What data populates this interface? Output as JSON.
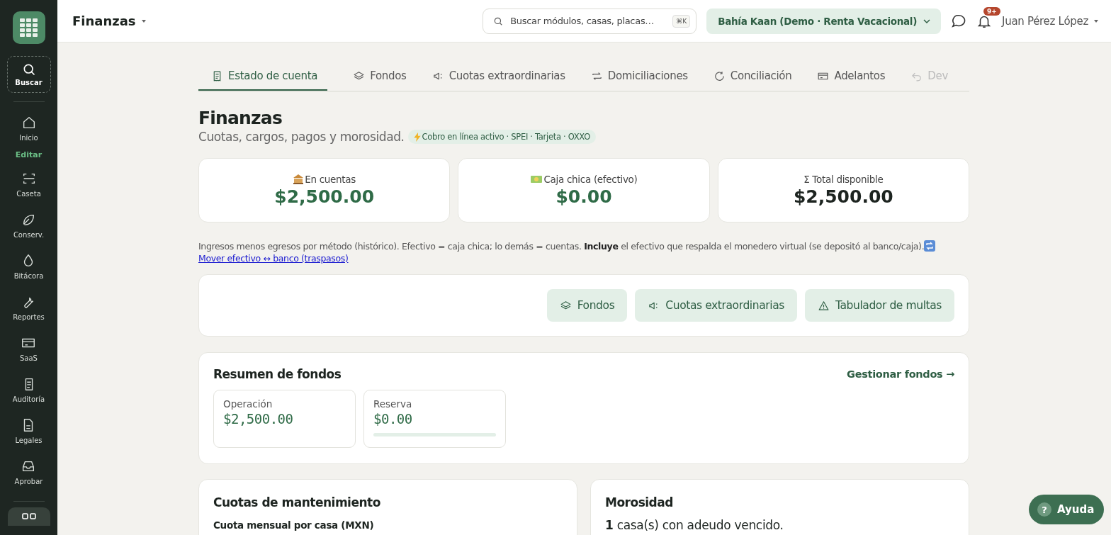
{
  "header": {
    "module": "Finanzas",
    "search": {
      "placeholder": "Buscar módulos, casas, placas…",
      "shortcut": "⌘K"
    },
    "property": "Bahía Kaan (Demo · Renta Vacacional)",
    "notifications": "9+",
    "user": "Juan Pérez López"
  },
  "sidebar": {
    "search": "Buscar",
    "items": [
      {
        "kind": "item",
        "label": "Inicio"
      },
      {
        "kind": "section",
        "label": "Editar"
      },
      {
        "kind": "item",
        "label": "Caseta"
      },
      {
        "kind": "item",
        "label": "Conserv."
      },
      {
        "kind": "item",
        "label": "Bitácora"
      },
      {
        "kind": "item",
        "label": "Reportes"
      },
      {
        "kind": "item",
        "label": "SaaS"
      },
      {
        "kind": "item",
        "label": "Auditoría"
      },
      {
        "kind": "item",
        "label": "Legales"
      },
      {
        "kind": "item",
        "label": "Aprobar"
      }
    ]
  },
  "tabs": [
    {
      "label": "Estado de cuenta",
      "selected": true
    },
    {
      "label": "Fondos",
      "selected": false
    },
    {
      "label": "Cuotas extraordinarias",
      "selected": false
    },
    {
      "label": "Domiciliaciones",
      "selected": false
    },
    {
      "label": "Conciliación",
      "selected": false
    },
    {
      "label": "Adelantos",
      "selected": false
    },
    {
      "label": "Dev",
      "selected": false
    }
  ],
  "page": {
    "title": "Finanzas",
    "subtitle": "Cuotas, cargos, pagos y morosidad.",
    "badge": "Cobro en línea activo · SPEI · Tarjeta · OXXO"
  },
  "balances": [
    {
      "label": "En cuentas",
      "amount": "$2,500.00",
      "accent": true
    },
    {
      "label": "Caja chica (efectivo)",
      "amount": "$0.00",
      "accent": true
    },
    {
      "label": "Σ Total disponible",
      "amount": "$2,500.00",
      "accent": false
    }
  ],
  "note": {
    "text": "Ingresos menos egresos por método (histórico). Efectivo = caja chica; lo demás = cuentas. **Incluye** el efectivo que respalda el monedero virtual (se depositó al banco/caja).",
    "link": "Mover efectivo ↔ banco (traspasos)"
  },
  "actions": [
    {
      "label": "Fondos"
    },
    {
      "label": "Cuotas extraordinarias"
    },
    {
      "label": "Tabulador de multas"
    }
  ],
  "funds": {
    "title": "Resumen de fondos",
    "link": "Gestionar fondos →",
    "items": [
      {
        "name": "Operación",
        "amount": "$2,500.00"
      },
      {
        "name": "Reserva",
        "amount": "$0.00",
        "level": 0
      }
    ]
  },
  "fees": {
    "title": "Cuotas de mantenimiento",
    "label": "Cuota mensual por casa (MXN)"
  },
  "delinquency": {
    "title": "Morosidad",
    "text": "**1** casa(s) con adeudo vencido."
  },
  "help": {
    "icon": "?",
    "label": "Ayuda"
  }
}
